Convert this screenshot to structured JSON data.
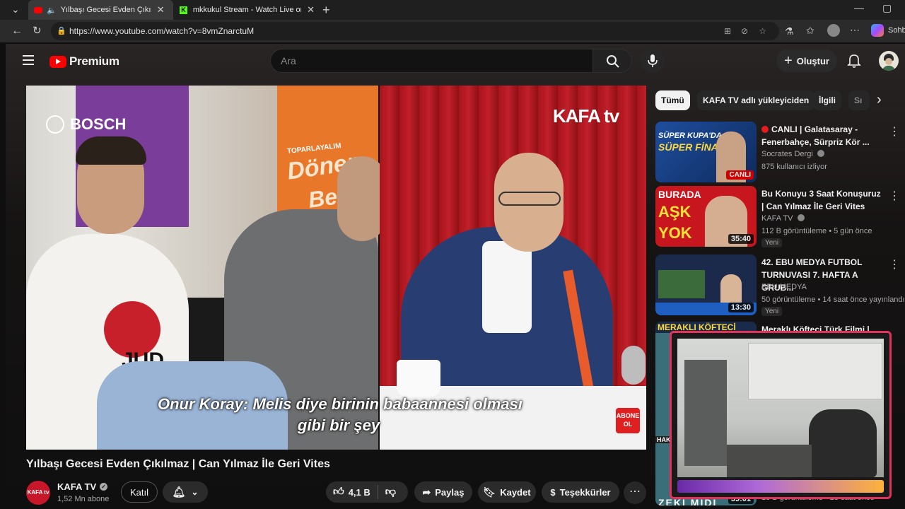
{
  "browser": {
    "tabs": [
      {
        "title": "Yılbaşı Gecesi Evden Çıkılmaz"
      },
      {
        "title": "mkkukul Stream - Watch Live on K"
      }
    ],
    "url": "https://www.youtube.com/watch?v=8vmZnarctuM",
    "profile_label": "Sohb"
  },
  "youtube": {
    "logo_text": "Premium",
    "search_placeholder": "Ara",
    "create_label": "Oluştur"
  },
  "video": {
    "brand_left": "BOSCH",
    "brand_right": "KAFA tv",
    "poster_lines": [
      "TOPARLAYALIM",
      "Döner",
      "Bek"
    ],
    "subtitle_line1": "Onur Koray: Melis diye birinin babaannesi olması",
    "subtitle_line2": "gibi bir şey",
    "abone_label": "ABONE OL",
    "title": "Yılbaşı Gecesi Evden Çıkılmaz | Can Yılmaz İle Geri Vites"
  },
  "channel": {
    "name": "KAFA TV",
    "subscribers": "1,52 Mn abone",
    "join_label": "Katıl",
    "avatar_text": "KAFA tv"
  },
  "actions": {
    "likes": "4,1 B",
    "share": "Paylaş",
    "save": "Kaydet",
    "thanks": "Teşekkürler"
  },
  "chips": [
    "Tümü",
    "KAFA TV adlı yükleyiciden",
    "İlgili",
    "Sı"
  ],
  "recommendations": [
    {
      "title": "CANLI | Galatasaray - Fenerbahçe, Sürpriz Kör ...",
      "channel": "Socrates Dergi",
      "meta": "875 kullanıcı izliyor",
      "thumb_text1": "SÜPER KUPA'DA",
      "thumb_text2": "SÜPER FİNAL",
      "live_badge": "CANLI"
    },
    {
      "title": "Bu Konuyu 3 Saat Konuşuruz | Can Yılmaz İle Geri Vites",
      "channel": "KAFA TV",
      "meta": "112 B görüntüleme • 5 gün önce",
      "badge": "Yeni",
      "duration": "35:40",
      "thumb_text1": "BURADA",
      "thumb_text2": "AŞK",
      "thumb_text3": "YOK"
    },
    {
      "title": "42. EBU MEDYA FUTBOL TURNUVASI 7. HAFTA A GRUB...",
      "channel": "EBU MEDYA",
      "meta": "50 görüntüleme • 14 saat önce yayınlandı",
      "badge": "Yeni",
      "duration": "13:30"
    },
    {
      "title": "Meraklı Köfteci Türk Filmi |",
      "thumb_text1": "MERAKLI KÖFTECİ",
      "duration": "39:01",
      "bottom_text": "ZEKİ MİDİ",
      "meta_tail": "18 B görüntüleme • 23 saat önce"
    }
  ],
  "side_labels": [
    "HAKA"
  ]
}
